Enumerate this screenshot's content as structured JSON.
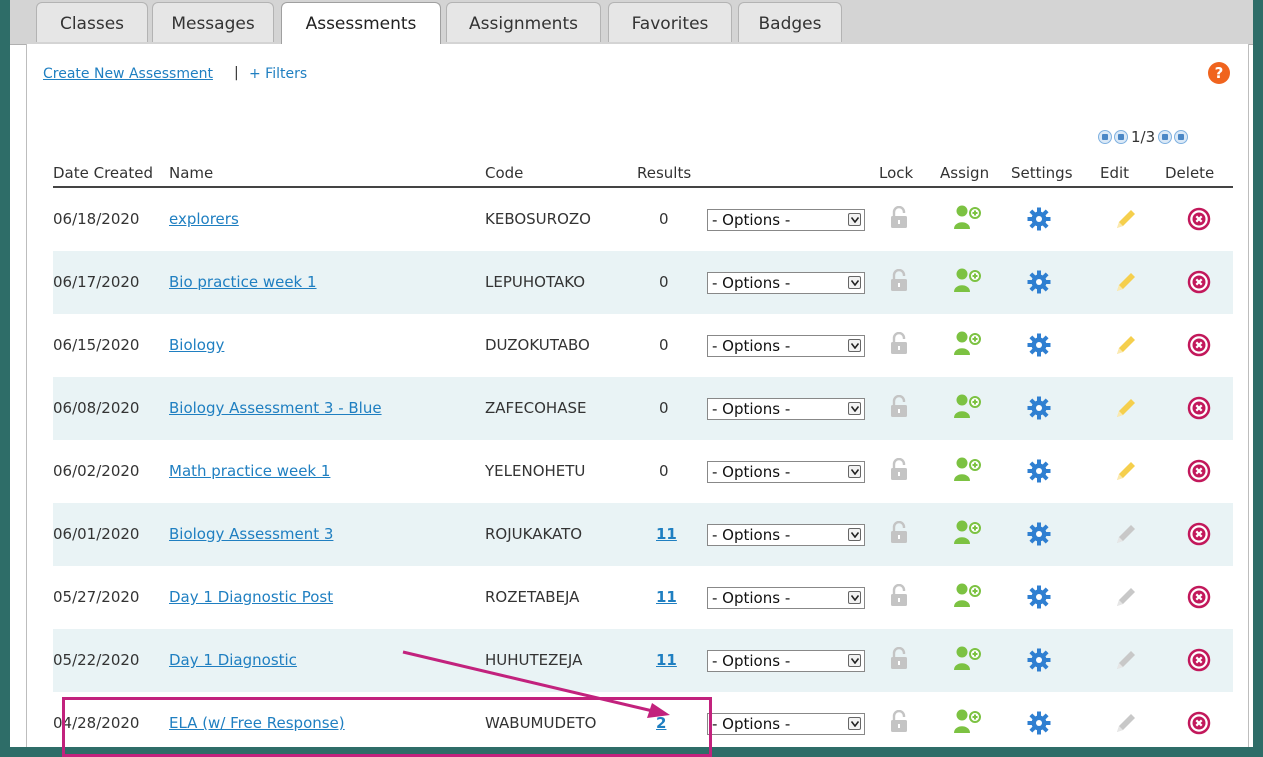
{
  "tabs": [
    {
      "label": "Classes",
      "active": false
    },
    {
      "label": "Messages",
      "active": false
    },
    {
      "label": "Assessments",
      "active": true
    },
    {
      "label": "Assignments",
      "active": false
    },
    {
      "label": "Favorites",
      "active": false
    },
    {
      "label": "Badges",
      "active": false
    }
  ],
  "toolbar": {
    "create_label": "Create New Assessment",
    "separator": "|",
    "filters_label": "+ Filters",
    "help_label": "?"
  },
  "pager": {
    "text": "1/3"
  },
  "table": {
    "headers": {
      "date": "Date Created",
      "name": "Name",
      "code": "Code",
      "results": "Results",
      "lock": "Lock",
      "assign": "Assign",
      "settings": "Settings",
      "edit": "Edit",
      "delete": "Delete"
    },
    "rows": [
      {
        "date": "06/18/2020",
        "name": "explorers",
        "code": "KEBOSUROZO",
        "results": "0",
        "options": "- Options -",
        "edit_active": true
      },
      {
        "date": "06/17/2020",
        "name": "Bio practice week 1",
        "code": "LEPUHOTAKO",
        "results": "0",
        "options": "- Options -",
        "edit_active": true
      },
      {
        "date": "06/15/2020",
        "name": "Biology",
        "code": "DUZOKUTABO",
        "results": "0",
        "options": "- Options -",
        "edit_active": true
      },
      {
        "date": "06/08/2020",
        "name": "Biology Assessment 3 - Blue",
        "code": "ZAFECOHASE",
        "results": "0",
        "options": "- Options -",
        "edit_active": true
      },
      {
        "date": "06/02/2020",
        "name": "Math practice week 1",
        "code": "YELENOHETU",
        "results": "0",
        "options": "- Options -",
        "edit_active": true
      },
      {
        "date": "06/01/2020",
        "name": "Biology Assessment 3",
        "code": "ROJUKAKATO",
        "results": "11",
        "options": "- Options -",
        "edit_active": false
      },
      {
        "date": "05/27/2020",
        "name": "Day 1 Diagnostic Post",
        "code": "ROZETABEJA",
        "results": "11",
        "options": "- Options -",
        "edit_active": false
      },
      {
        "date": "05/22/2020",
        "name": "Day 1 Diagnostic",
        "code": "HUHUTEZEJA",
        "results": "11",
        "options": "- Options -",
        "edit_active": false
      },
      {
        "date": "04/28/2020",
        "name": "ELA (w/ Free Response)",
        "code": "WABUMUDETO",
        "results": "2",
        "options": "- Options -",
        "edit_active": false
      }
    ]
  },
  "colors": {
    "link": "#1f7fc1",
    "assign_green": "#7cc242",
    "settings_blue": "#2f7fd1",
    "edit_yellow": "#f5cf4d",
    "edit_gray": "#c8c8c8",
    "delete_red": "#c2185b",
    "highlight": "#c2227d",
    "row_alt": "#e9f3f5",
    "help_orange": "#f0641e"
  },
  "icons": {
    "lock": "lock-icon",
    "assign": "assign-user-icon",
    "settings": "gear-icon",
    "edit": "pencil-icon",
    "delete": "delete-circle-icon"
  }
}
